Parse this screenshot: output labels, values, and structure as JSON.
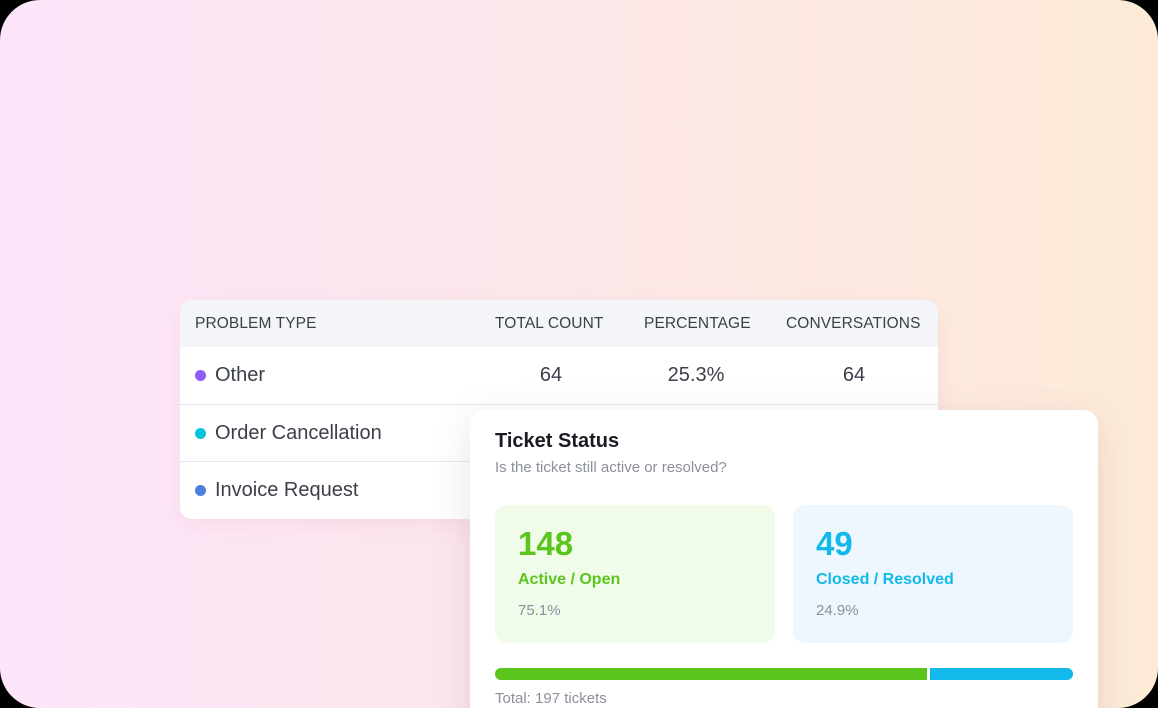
{
  "problem_table": {
    "columns": {
      "type": "PROBLEM TYPE",
      "count": "TOTAL COUNT",
      "percentage": "PERCENTAGE",
      "conversations": "CONVERSATIONS"
    },
    "rows": [
      {
        "type": "Other",
        "dot_color": "#8b5cf6",
        "count": "64",
        "percentage": "25.3%",
        "conversations": "64"
      },
      {
        "type": "Order Cancellation",
        "dot_color": "#06c4dd",
        "count": "",
        "percentage": "",
        "conversations": ""
      },
      {
        "type": "Invoice Request",
        "dot_color": "#4a7fe0",
        "count": "",
        "percentage": "",
        "conversations": ""
      }
    ]
  },
  "ticket_status": {
    "title": "Ticket Status",
    "subtitle": "Is the ticket still active or resolved?",
    "active": {
      "count": "148",
      "label": "Active / Open",
      "percentage": "75.1%",
      "color": "#5ac51c",
      "fraction": 0.751
    },
    "closed": {
      "count": "49",
      "label": "Closed / Resolved",
      "percentage": "24.9%",
      "color": "#12b9ea",
      "fraction": 0.249
    },
    "total": "Total: 197 tickets"
  }
}
